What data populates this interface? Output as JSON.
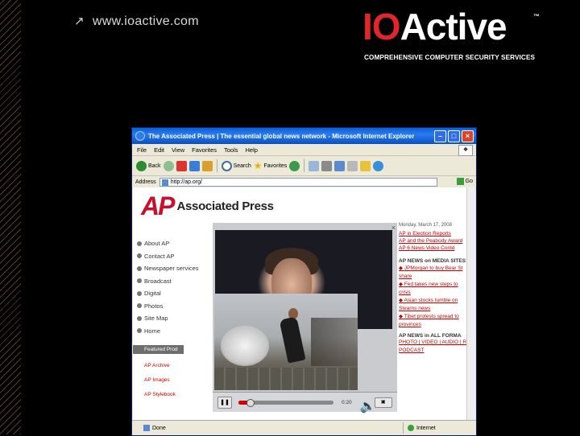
{
  "slide": {
    "url": "www.ioactive.com",
    "logo_text": "IOActive",
    "logo_tm": "™",
    "tagline": "COMPREHENSIVE COMPUTER SECURITY SERVICES",
    "colors": {
      "brand_red": "#e0262b",
      "background": "#000000"
    }
  },
  "browser": {
    "title": "The Associated Press | The essential global news network - Microsoft Internet Explorer",
    "menu": [
      "File",
      "Edit",
      "View",
      "Favorites",
      "Tools",
      "Help"
    ],
    "toolbar": {
      "back": "Back",
      "search": "Search",
      "favorites": "Favorites"
    },
    "address_label": "Address",
    "address_value": "http://ap.org/",
    "go_label": "Go",
    "status_left": "Done",
    "status_right": "Internet"
  },
  "page": {
    "ap_mark": "AP",
    "ap_name": "Associated Press",
    "nav": [
      "About AP",
      "Contact AP",
      "Newspaper services",
      "Broadcast",
      "Digital",
      "Photos",
      "Site Map",
      "Home"
    ],
    "featured_header": "Featured Prod",
    "featured_links": [
      "AP Archive",
      "AP Images",
      "AP Stylebook"
    ],
    "right": {
      "date": "Monday, March 17, 2008",
      "links_top": [
        "AP in Election Reports",
        "AP and the Peabody Award",
        "AP 6 News Video Contd"
      ],
      "heading1": "AP NEWS on MEDIA SITES",
      "items": [
        {
          "bullet": "◆",
          "text": "JPMorgan to buy Bear St"
        },
        {
          "bullet": "",
          "text": "share"
        },
        {
          "bullet": "◆",
          "text": "Fed takes new steps to"
        },
        {
          "bullet": "",
          "text": "crisis"
        },
        {
          "bullet": "◆",
          "text": "Asian stocks tumble on"
        },
        {
          "bullet": "",
          "text": "Stearns news"
        },
        {
          "bullet": "◆",
          "text": "Tibet protests spread to"
        },
        {
          "bullet": "",
          "text": "provinces"
        }
      ],
      "heading2": "AP NEWS in ALL FORMA",
      "formats": "PHOTO | VIDEO | AUDIO | RS",
      "podcast": "PODCAST"
    }
  },
  "player": {
    "timecode": "0:20",
    "progress": 0.12
  }
}
